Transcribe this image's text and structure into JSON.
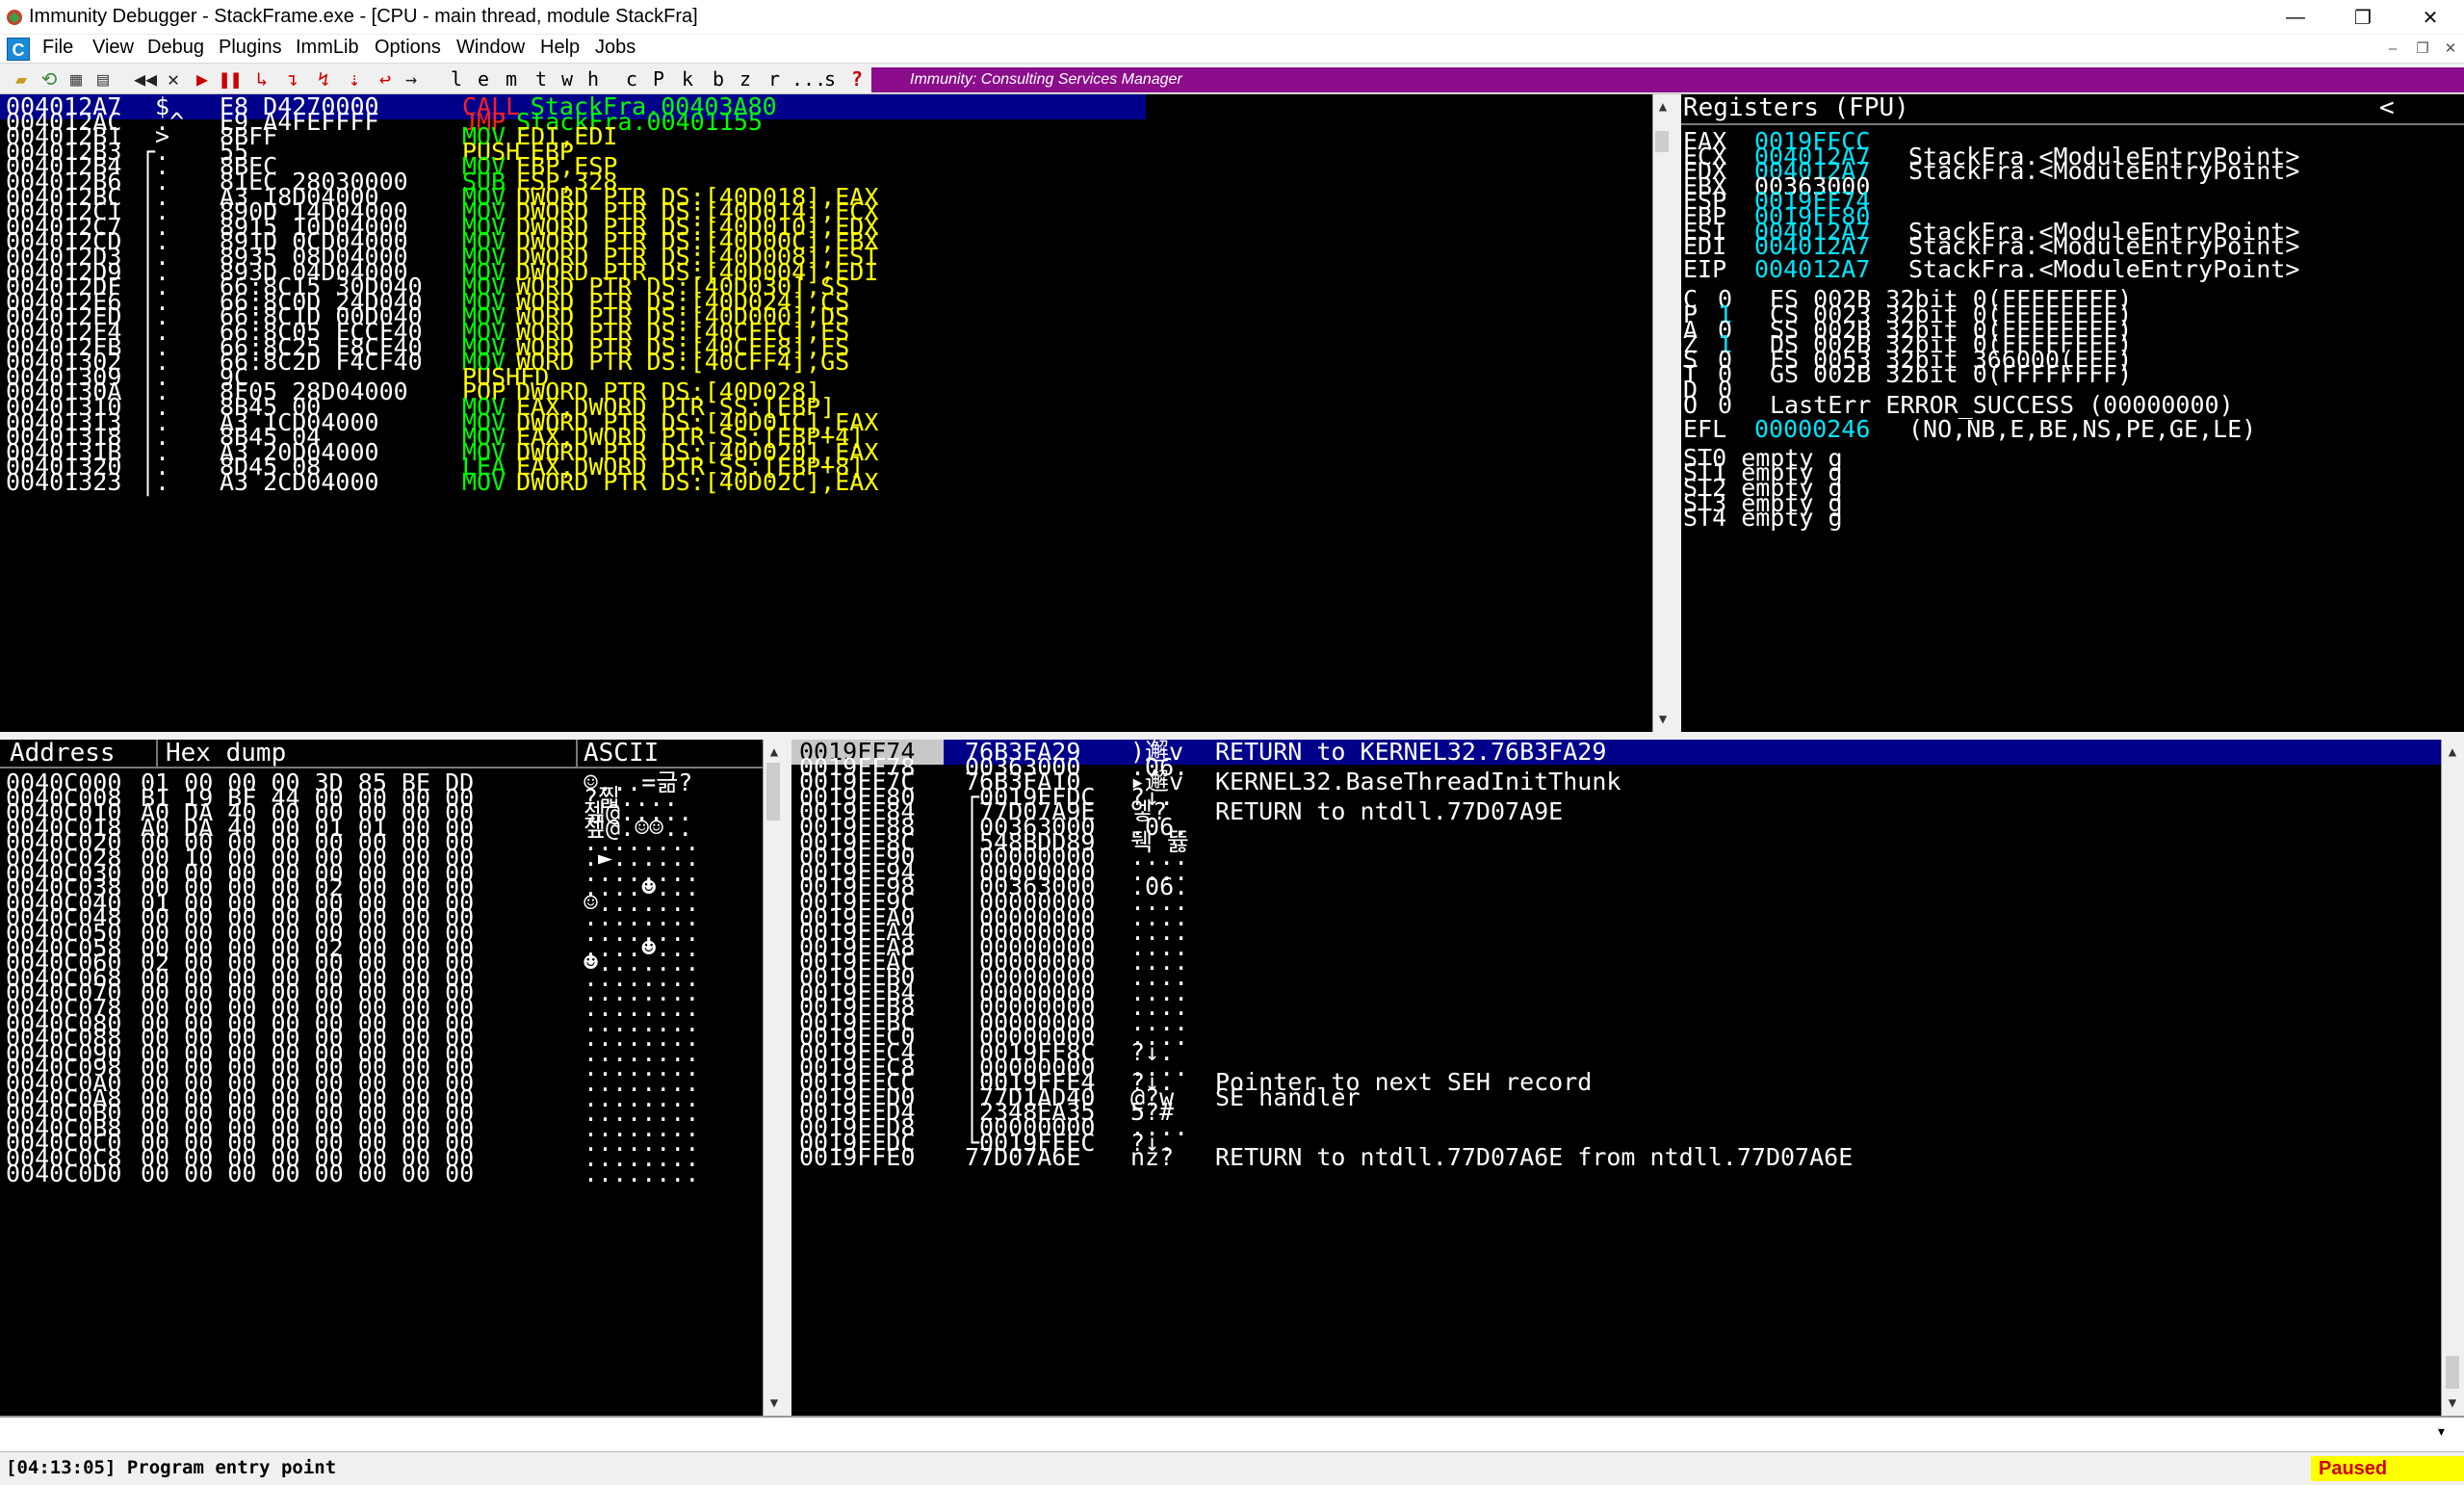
{
  "window": {
    "title": "Immunity Debugger - StackFrame.exe - [CPU - main thread, module StackFra]",
    "minimize": "—",
    "restore": "❐",
    "close": "✕"
  },
  "menu": [
    "File",
    "View",
    "Debug",
    "Plugins",
    "ImmLib",
    "Options",
    "Window",
    "Help",
    "Jobs"
  ],
  "mdi_icon": "C",
  "toolbar": {
    "icons": [
      "open-icon",
      "restart-icon",
      "close-file-icon",
      "attach-icon",
      "rewind-icon",
      "stop-icon",
      "run-icon",
      "pause-icon",
      "step-into-icon",
      "step-over-icon",
      "trace-into-icon",
      "trace-over-icon",
      "execute-till-return-icon",
      "goto-icon"
    ],
    "letters": [
      "l",
      "e",
      "m",
      "t",
      "w",
      "h",
      "c",
      "P",
      "k",
      "b",
      "z",
      "r",
      "...",
      "s",
      "?"
    ],
    "promo": "Immunity: Consulting Services Manager"
  },
  "disasm": [
    {
      "addr": "004012A7",
      "mark": " $",
      "hex": "E8 D4270000",
      "mn": "CALL",
      "mc": "r",
      "op": "StackFra.00403A80",
      "oc": "g",
      "sel": true
    },
    {
      "addr": "004012AC",
      "mark": " .^",
      "hex": "E9 A4FEFFFF",
      "mn": "JMP",
      "mc": "r",
      "op": "StackFra.00401155",
      "oc": "g"
    },
    {
      "addr": "004012B1",
      "mark": " >",
      "hex": "8BFF",
      "mn": "MOV",
      "mc": "g",
      "op": "EDI,EDI",
      "oc": "y"
    },
    {
      "addr": "004012B3",
      "mark": "┌.",
      "hex": "55",
      "mn": "PUSH",
      "mc": "y",
      "op": "EBP",
      "oc": "y"
    },
    {
      "addr": "004012B4",
      "mark": "│.",
      "hex": "8BEC",
      "mn": "MOV",
      "mc": "g",
      "op": "EBP,ESP",
      "oc": "y"
    },
    {
      "addr": "004012B6",
      "mark": "│.",
      "hex": "81EC 28030000",
      "mn": "SUB",
      "mc": "g",
      "op": "ESP,328",
      "oc": "y"
    },
    {
      "addr": "004012BC",
      "mark": "│.",
      "hex": "A3 18D04000",
      "mn": "MOV",
      "mc": "g",
      "op": "DWORD PTR DS:[40D018],EAX",
      "oc": "y"
    },
    {
      "addr": "004012C1",
      "mark": "│.",
      "hex": "890D 14D04000",
      "mn": "MOV",
      "mc": "g",
      "op": "DWORD PTR DS:[40D014],ECX",
      "oc": "y"
    },
    {
      "addr": "004012C7",
      "mark": "│.",
      "hex": "8915 10D04000",
      "mn": "MOV",
      "mc": "g",
      "op": "DWORD PTR DS:[40D010],EDX",
      "oc": "y"
    },
    {
      "addr": "004012CD",
      "mark": "│.",
      "hex": "891D 0CD04000",
      "mn": "MOV",
      "mc": "g",
      "op": "DWORD PTR DS:[40D00C],EBX",
      "oc": "y"
    },
    {
      "addr": "004012D3",
      "mark": "│.",
      "hex": "8935 08D04000",
      "mn": "MOV",
      "mc": "g",
      "op": "DWORD PTR DS:[40D008],ESI",
      "oc": "y"
    },
    {
      "addr": "004012D9",
      "mark": "│.",
      "hex": "893D 04D04000",
      "mn": "MOV",
      "mc": "g",
      "op": "DWORD PTR DS:[40D004],EDI",
      "oc": "y"
    },
    {
      "addr": "004012DF",
      "mark": "│.",
      "hex": "66:8C15 30D040",
      "mn": "MOV",
      "mc": "g",
      "op": "WORD PTR DS:[40D030],SS",
      "oc": "y"
    },
    {
      "addr": "004012E6",
      "mark": "│.",
      "hex": "66:8C0D 24D040",
      "mn": "MOV",
      "mc": "g",
      "op": "WORD PTR DS:[40D024],CS",
      "oc": "y"
    },
    {
      "addr": "004012ED",
      "mark": "│.",
      "hex": "66:8C1D 00D040",
      "mn": "MOV",
      "mc": "g",
      "op": "WORD PTR DS:[40D000],DS",
      "oc": "y"
    },
    {
      "addr": "004012F4",
      "mark": "│.",
      "hex": "66:8C05 FCCF40",
      "mn": "MOV",
      "mc": "g",
      "op": "WORD PTR DS:[40CFFC],ES",
      "oc": "y"
    },
    {
      "addr": "004012FB",
      "mark": "│.",
      "hex": "66:8C25 F8CF40",
      "mn": "MOV",
      "mc": "g",
      "op": "WORD PTR DS:[40CFF8],FS",
      "oc": "y"
    },
    {
      "addr": "00401302",
      "mark": "│.",
      "hex": "66:8C2D F4CF40",
      "mn": "MOV",
      "mc": "g",
      "op": "WORD PTR DS:[40CFF4],GS",
      "oc": "y"
    },
    {
      "addr": "00401309",
      "mark": "│.",
      "hex": "9C",
      "mn": "PUSHFD",
      "mc": "y",
      "op": "",
      "oc": "y"
    },
    {
      "addr": "0040130A",
      "mark": "│.",
      "hex": "8F05 28D04000",
      "mn": "POP",
      "mc": "y",
      "op": "DWORD PTR DS:[40D028]",
      "oc": "y"
    },
    {
      "addr": "00401310",
      "mark": "│.",
      "hex": "8B45 00",
      "mn": "MOV",
      "mc": "g",
      "op": "EAX,DWORD PTR SS:[EBP]",
      "oc": "y"
    },
    {
      "addr": "00401313",
      "mark": "│.",
      "hex": "A3 1CD04000",
      "mn": "MOV",
      "mc": "g",
      "op": "DWORD PTR DS:[40D01C],EAX",
      "oc": "y"
    },
    {
      "addr": "00401318",
      "mark": "│.",
      "hex": "8B45 04",
      "mn": "MOV",
      "mc": "g",
      "op": "EAX,DWORD PTR SS:[EBP+4]",
      "oc": "y"
    },
    {
      "addr": "0040131B",
      "mark": "│.",
      "hex": "A3 20D04000",
      "mn": "MOV",
      "mc": "g",
      "op": "DWORD PTR DS:[40D020],EAX",
      "oc": "y"
    },
    {
      "addr": "00401320",
      "mark": "│.",
      "hex": "8D45 08",
      "mn": "LEA",
      "mc": "g",
      "op": "EAX,DWORD PTR SS:[EBP+8]",
      "oc": "y"
    },
    {
      "addr": "00401323",
      "mark": "│.",
      "hex": "A3 2CD04000",
      "mn": "MOV",
      "mc": "g",
      "op": "DWORD PTR DS:[40D02C],EAX",
      "oc": "y"
    }
  ],
  "registers": {
    "title": "Registers (FPU)",
    "collapse": "<",
    "gp": [
      {
        "name": "EAX",
        "val": "0019FFCC",
        "info": ""
      },
      {
        "name": "ECX",
        "val": "004012A7",
        "info": "StackFra.<ModuleEntryPoint>"
      },
      {
        "name": "EDX",
        "val": "004012A7",
        "info": "StackFra.<ModuleEntryPoint>"
      },
      {
        "name": "EBX",
        "val": "00363000",
        "info": "",
        "dim": true
      },
      {
        "name": "ESP",
        "val": "0019FF74",
        "info": ""
      },
      {
        "name": "EBP",
        "val": "0019FF80",
        "info": ""
      },
      {
        "name": "ESI",
        "val": "004012A7",
        "info": "StackFra.<ModuleEntryPoint>"
      },
      {
        "name": "EDI",
        "val": "004012A7",
        "info": "StackFra.<ModuleEntryPoint>"
      }
    ],
    "eip": {
      "name": "EIP",
      "val": "004012A7",
      "info": "StackFra.<ModuleEntryPoint>"
    },
    "flags": [
      {
        "f": "C",
        "v": "0",
        "seg": "ES 002B 32bit 0(FFFFFFFF)"
      },
      {
        "f": "P",
        "v": "1",
        "seg": "CS 0023 32bit 0(FFFFFFFF)"
      },
      {
        "f": "A",
        "v": "0",
        "seg": "SS 002B 32bit 0(FFFFFFFF)"
      },
      {
        "f": "Z",
        "v": "1",
        "seg": "DS 002B 32bit 0(FFFFFFFF)"
      },
      {
        "f": "S",
        "v": "0",
        "seg": "FS 0053 32bit 366000(FFF)"
      },
      {
        "f": "T",
        "v": "0",
        "seg": "GS 002B 32bit 0(FFFFFFFF)"
      },
      {
        "f": "D",
        "v": "0",
        "seg": ""
      },
      {
        "f": "O",
        "v": "0",
        "seg": "LastErr ERROR_SUCCESS (00000000)"
      }
    ],
    "efl": {
      "name": "EFL",
      "val": "00000246",
      "info": "(NO,NB,E,BE,NS,PE,GE,LE)"
    },
    "fpu": [
      "ST0 empty g",
      "ST1 empty g",
      "ST2 empty g",
      "ST3 empty g",
      "ST4 empty g"
    ]
  },
  "dump": {
    "headers": {
      "address": "Address",
      "hex": "Hex dump",
      "ascii": "ASCII"
    },
    "rows": [
      {
        "addr": "0040C000",
        "hex": "01 00 00 00 3D 85 BE DD",
        "ascii": "☺...=긂?"
      },
      {
        "addr": "0040C008",
        "hex": "B1 19 BF 44 00 00 00 00",
        "ascii": "?찗...."
      },
      {
        "addr": "0040C010",
        "hex": "A0 DA 40 00 00 00 00 00",
        "ascii": "젶@....."
      },
      {
        "addr": "0040C018",
        "hex": "A0 DA 40 00 01 01 00 00",
        "ascii": "젶@.☺☺.."
      },
      {
        "addr": "0040C020",
        "hex": "00 00 00 00 00 00 00 00",
        "ascii": "........"
      },
      {
        "addr": "0040C028",
        "hex": "00 10 00 00 00 00 00 00",
        "ascii": ".►......"
      },
      {
        "addr": "0040C030",
        "hex": "00 00 00 00 00 00 00 00",
        "ascii": "........"
      },
      {
        "addr": "0040C038",
        "hex": "00 00 00 00 02 00 00 00",
        "ascii": "....☻..."
      },
      {
        "addr": "0040C040",
        "hex": "01 00 00 00 00 00 00 00",
        "ascii": "☺......."
      },
      {
        "addr": "0040C048",
        "hex": "00 00 00 00 00 00 00 00",
        "ascii": "........"
      },
      {
        "addr": "0040C050",
        "hex": "00 00 00 00 00 00 00 00",
        "ascii": "........"
      },
      {
        "addr": "0040C058",
        "hex": "00 00 00 00 02 00 00 00",
        "ascii": "....☻..."
      },
      {
        "addr": "0040C060",
        "hex": "02 00 00 00 00 00 00 00",
        "ascii": "☻......."
      },
      {
        "addr": "0040C068",
        "hex": "00 00 00 00 00 00 00 00",
        "ascii": "........"
      },
      {
        "addr": "0040C070",
        "hex": "00 00 00 00 00 00 00 00",
        "ascii": "........"
      },
      {
        "addr": "0040C078",
        "hex": "00 00 00 00 00 00 00 00",
        "ascii": "........"
      },
      {
        "addr": "0040C080",
        "hex": "00 00 00 00 00 00 00 00",
        "ascii": "........"
      },
      {
        "addr": "0040C088",
        "hex": "00 00 00 00 00 00 00 00",
        "ascii": "........"
      },
      {
        "addr": "0040C090",
        "hex": "00 00 00 00 00 00 00 00",
        "ascii": "........"
      },
      {
        "addr": "0040C098",
        "hex": "00 00 00 00 00 00 00 00",
        "ascii": "........"
      },
      {
        "addr": "0040C0A0",
        "hex": "00 00 00 00 00 00 00 00",
        "ascii": "........"
      },
      {
        "addr": "0040C0A8",
        "hex": "00 00 00 00 00 00 00 00",
        "ascii": "........"
      },
      {
        "addr": "0040C0B0",
        "hex": "00 00 00 00 00 00 00 00",
        "ascii": "........"
      },
      {
        "addr": "0040C0B8",
        "hex": "00 00 00 00 00 00 00 00",
        "ascii": "........"
      },
      {
        "addr": "0040C0C0",
        "hex": "00 00 00 00 00 00 00 00",
        "ascii": "........"
      },
      {
        "addr": "0040C0C8",
        "hex": "00 00 00 00 00 00 00 00",
        "ascii": "........"
      },
      {
        "addr": "0040C0D0",
        "hex": "00 00 00 00 00 00 00 00",
        "ascii": "........"
      }
    ]
  },
  "stack": [
    {
      "addr": "0019FF74",
      "val": "76B3FA29",
      "ascii": ")邂v",
      "cmt": "RETURN to KERNEL32.76B3FA29",
      "sel": true
    },
    {
      "addr": "0019FF78",
      "val": "00363000",
      "ascii": ".06.",
      "cmt": ""
    },
    {
      "addr": "0019FF7C",
      "val": "76B3FA10",
      "ascii": "▸邂v",
      "cmt": "KERNEL32.BaseThreadInitThunk"
    },
    {
      "addr": "0019FF80",
      "val": "┌0019FFDC",
      "ascii": "?↓.",
      "cmt": ""
    },
    {
      "addr": "0019FF84",
      "val": "│77D07A9E",
      "ascii": "엫?",
      "cmt": "RETURN to ntdll.77D07A9E"
    },
    {
      "addr": "0019FF88",
      "val": "│00363000",
      "ascii": ".06.",
      "cmt": ""
    },
    {
      "addr": "0019FF8C",
      "val": "│548BDD89",
      "ascii": "뒉 뜛",
      "cmt": ""
    },
    {
      "addr": "0019FF90",
      "val": "│00000000",
      "ascii": "....",
      "cmt": ""
    },
    {
      "addr": "0019FF94",
      "val": "│00000000",
      "ascii": "....",
      "cmt": ""
    },
    {
      "addr": "0019FF98",
      "val": "│00363000",
      "ascii": ".06.",
      "cmt": ""
    },
    {
      "addr": "0019FF9C",
      "val": "│00000000",
      "ascii": "....",
      "cmt": ""
    },
    {
      "addr": "0019FFA0",
      "val": "│00000000",
      "ascii": "....",
      "cmt": ""
    },
    {
      "addr": "0019FFA4",
      "val": "│00000000",
      "ascii": "....",
      "cmt": ""
    },
    {
      "addr": "0019FFA8",
      "val": "│00000000",
      "ascii": "....",
      "cmt": ""
    },
    {
      "addr": "0019FFAC",
      "val": "│00000000",
      "ascii": "....",
      "cmt": ""
    },
    {
      "addr": "0019FFB0",
      "val": "│00000000",
      "ascii": "....",
      "cmt": ""
    },
    {
      "addr": "0019FFB4",
      "val": "│00000000",
      "ascii": "....",
      "cmt": ""
    },
    {
      "addr": "0019FFB8",
      "val": "│00000000",
      "ascii": "....",
      "cmt": ""
    },
    {
      "addr": "0019FFBC",
      "val": "│00000000",
      "ascii": "....",
      "cmt": ""
    },
    {
      "addr": "0019FFC0",
      "val": "│00000000",
      "ascii": "....",
      "cmt": ""
    },
    {
      "addr": "0019FFC4",
      "val": "│0019FF8C",
      "ascii": "?↓.",
      "cmt": ""
    },
    {
      "addr": "0019FFC8",
      "val": "│00000000",
      "ascii": "....",
      "cmt": ""
    },
    {
      "addr": "0019FFCC",
      "val": "│0019FFE4",
      "ascii": "?↓.",
      "cmt": "Pointer to next SEH record"
    },
    {
      "addr": "0019FFD0",
      "val": "│77D1AD40",
      "ascii": "@?w",
      "cmt": "SE handler"
    },
    {
      "addr": "0019FFD4",
      "val": "│2348EA35",
      "ascii": "5?#",
      "cmt": ""
    },
    {
      "addr": "0019FFD8",
      "val": "│00000000",
      "ascii": "....",
      "cmt": ""
    },
    {
      "addr": "0019FFDC",
      "val": "└0019FFEC",
      "ascii": "?↓.",
      "cmt": ""
    },
    {
      "addr": "0019FFE0",
      "val": "77D07A6E",
      "ascii": "nz?",
      "cmt": "RETURN to ntdll.77D07A6E from ntdll.77D07A6E"
    }
  ],
  "command": {
    "value": "",
    "dropdown": "▾"
  },
  "status": {
    "message": "[04:13:05] Program entry point",
    "state": "Paused"
  }
}
